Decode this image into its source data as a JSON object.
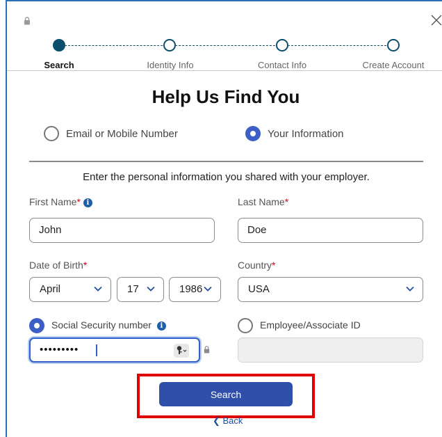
{
  "steps": [
    {
      "label": "Search",
      "active": true
    },
    {
      "label": "Identity Info",
      "active": false
    },
    {
      "label": "Contact Info",
      "active": false
    },
    {
      "label": "Create Account",
      "active": false
    }
  ],
  "title": "Help Us Find You",
  "search_mode": {
    "options": [
      "Email or Mobile Number",
      "Your Information"
    ],
    "selected": "Your Information"
  },
  "instruction": "Enter the personal information you shared with your employer.",
  "form": {
    "first_name": {
      "label": "First Name",
      "required": "*",
      "value": "John"
    },
    "last_name": {
      "label": "Last Name",
      "required": "*",
      "value": "Doe"
    },
    "dob": {
      "label": "Date of Birth",
      "required": "*",
      "month": "April",
      "day": "17",
      "year": "1986"
    },
    "country": {
      "label": "Country",
      "required": "*",
      "value": "USA"
    },
    "id_type": {
      "ssn_label": "Social Security number",
      "employee_label": "Employee/Associate ID",
      "selected": "Social Security number"
    },
    "ssn_value": "•••••••••",
    "employee_value": ""
  },
  "search_button": "Search",
  "back_link": "Back",
  "colors": {
    "brand": "#0b4f6c",
    "primary": "#2f4fa8",
    "required": "#d0021b",
    "highlight": "#e00000"
  }
}
